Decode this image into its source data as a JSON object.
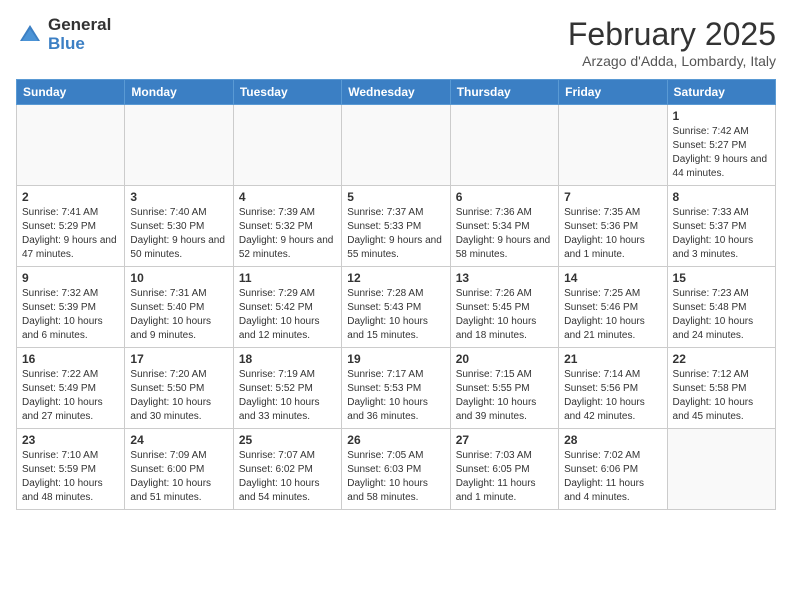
{
  "logo": {
    "general": "General",
    "blue": "Blue"
  },
  "header": {
    "title": "February 2025",
    "subtitle": "Arzago d'Adda, Lombardy, Italy"
  },
  "weekdays": [
    "Sunday",
    "Monday",
    "Tuesday",
    "Wednesday",
    "Thursday",
    "Friday",
    "Saturday"
  ],
  "weeks": [
    [
      {
        "day": "",
        "info": ""
      },
      {
        "day": "",
        "info": ""
      },
      {
        "day": "",
        "info": ""
      },
      {
        "day": "",
        "info": ""
      },
      {
        "day": "",
        "info": ""
      },
      {
        "day": "",
        "info": ""
      },
      {
        "day": "1",
        "info": "Sunrise: 7:42 AM\nSunset: 5:27 PM\nDaylight: 9 hours and 44 minutes."
      }
    ],
    [
      {
        "day": "2",
        "info": "Sunrise: 7:41 AM\nSunset: 5:29 PM\nDaylight: 9 hours and 47 minutes."
      },
      {
        "day": "3",
        "info": "Sunrise: 7:40 AM\nSunset: 5:30 PM\nDaylight: 9 hours and 50 minutes."
      },
      {
        "day": "4",
        "info": "Sunrise: 7:39 AM\nSunset: 5:32 PM\nDaylight: 9 hours and 52 minutes."
      },
      {
        "day": "5",
        "info": "Sunrise: 7:37 AM\nSunset: 5:33 PM\nDaylight: 9 hours and 55 minutes."
      },
      {
        "day": "6",
        "info": "Sunrise: 7:36 AM\nSunset: 5:34 PM\nDaylight: 9 hours and 58 minutes."
      },
      {
        "day": "7",
        "info": "Sunrise: 7:35 AM\nSunset: 5:36 PM\nDaylight: 10 hours and 1 minute."
      },
      {
        "day": "8",
        "info": "Sunrise: 7:33 AM\nSunset: 5:37 PM\nDaylight: 10 hours and 3 minutes."
      }
    ],
    [
      {
        "day": "9",
        "info": "Sunrise: 7:32 AM\nSunset: 5:39 PM\nDaylight: 10 hours and 6 minutes."
      },
      {
        "day": "10",
        "info": "Sunrise: 7:31 AM\nSunset: 5:40 PM\nDaylight: 10 hours and 9 minutes."
      },
      {
        "day": "11",
        "info": "Sunrise: 7:29 AM\nSunset: 5:42 PM\nDaylight: 10 hours and 12 minutes."
      },
      {
        "day": "12",
        "info": "Sunrise: 7:28 AM\nSunset: 5:43 PM\nDaylight: 10 hours and 15 minutes."
      },
      {
        "day": "13",
        "info": "Sunrise: 7:26 AM\nSunset: 5:45 PM\nDaylight: 10 hours and 18 minutes."
      },
      {
        "day": "14",
        "info": "Sunrise: 7:25 AM\nSunset: 5:46 PM\nDaylight: 10 hours and 21 minutes."
      },
      {
        "day": "15",
        "info": "Sunrise: 7:23 AM\nSunset: 5:48 PM\nDaylight: 10 hours and 24 minutes."
      }
    ],
    [
      {
        "day": "16",
        "info": "Sunrise: 7:22 AM\nSunset: 5:49 PM\nDaylight: 10 hours and 27 minutes."
      },
      {
        "day": "17",
        "info": "Sunrise: 7:20 AM\nSunset: 5:50 PM\nDaylight: 10 hours and 30 minutes."
      },
      {
        "day": "18",
        "info": "Sunrise: 7:19 AM\nSunset: 5:52 PM\nDaylight: 10 hours and 33 minutes."
      },
      {
        "day": "19",
        "info": "Sunrise: 7:17 AM\nSunset: 5:53 PM\nDaylight: 10 hours and 36 minutes."
      },
      {
        "day": "20",
        "info": "Sunrise: 7:15 AM\nSunset: 5:55 PM\nDaylight: 10 hours and 39 minutes."
      },
      {
        "day": "21",
        "info": "Sunrise: 7:14 AM\nSunset: 5:56 PM\nDaylight: 10 hours and 42 minutes."
      },
      {
        "day": "22",
        "info": "Sunrise: 7:12 AM\nSunset: 5:58 PM\nDaylight: 10 hours and 45 minutes."
      }
    ],
    [
      {
        "day": "23",
        "info": "Sunrise: 7:10 AM\nSunset: 5:59 PM\nDaylight: 10 hours and 48 minutes."
      },
      {
        "day": "24",
        "info": "Sunrise: 7:09 AM\nSunset: 6:00 PM\nDaylight: 10 hours and 51 minutes."
      },
      {
        "day": "25",
        "info": "Sunrise: 7:07 AM\nSunset: 6:02 PM\nDaylight: 10 hours and 54 minutes."
      },
      {
        "day": "26",
        "info": "Sunrise: 7:05 AM\nSunset: 6:03 PM\nDaylight: 10 hours and 58 minutes."
      },
      {
        "day": "27",
        "info": "Sunrise: 7:03 AM\nSunset: 6:05 PM\nDaylight: 11 hours and 1 minute."
      },
      {
        "day": "28",
        "info": "Sunrise: 7:02 AM\nSunset: 6:06 PM\nDaylight: 11 hours and 4 minutes."
      },
      {
        "day": "",
        "info": ""
      }
    ]
  ]
}
